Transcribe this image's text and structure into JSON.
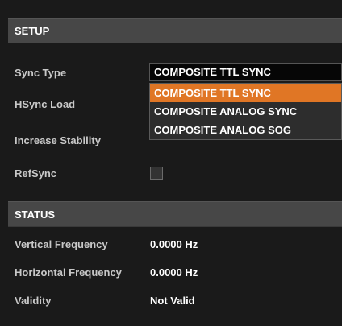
{
  "colors": {
    "background": "#1a1a1a",
    "header_bg": "#474747",
    "accent_selected": "#e07625",
    "dropdown_bg": "#2d2d2d",
    "select_bg": "#060606"
  },
  "setup": {
    "title": "SETUP",
    "sync_type": {
      "label": "Sync Type",
      "selected": "COMPOSITE TTL SYNC",
      "options": [
        "COMPOSITE TTL SYNC",
        "COMPOSITE ANALOG SYNC",
        "COMPOSITE ANALOG SOG"
      ]
    },
    "hsync_load": {
      "label": "HSync Load"
    },
    "increase_stability": {
      "label": "Increase Stability"
    },
    "refsync": {
      "label": "RefSync",
      "checked": false
    }
  },
  "status": {
    "title": "STATUS",
    "vertical_frequency": {
      "label": "Vertical Frequency",
      "value": "0.0000 Hz"
    },
    "horizontal_frequency": {
      "label": "Horizontal Frequency",
      "value": "0.0000 Hz"
    },
    "validity": {
      "label": "Validity",
      "value": "Not Valid"
    }
  }
}
